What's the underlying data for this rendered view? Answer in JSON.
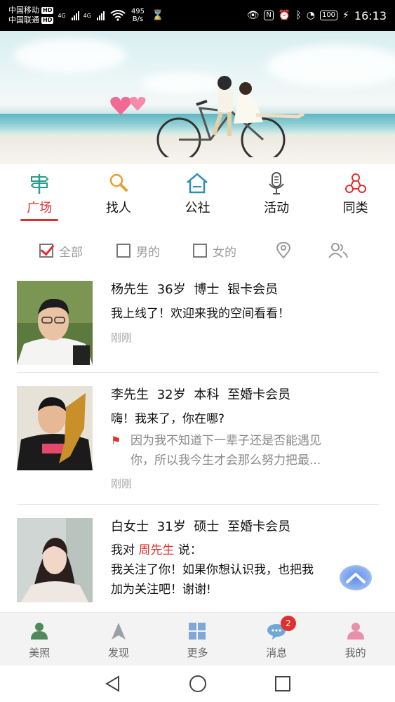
{
  "status_bar": {
    "carrier1": "中国移动",
    "carrier2": "中国联通",
    "hd_label": "HD",
    "net1": "4G",
    "net2": "4G",
    "speed_value": "495",
    "speed_unit": "B/s",
    "battery": "100",
    "time": "16:13"
  },
  "top_nav": {
    "items": [
      {
        "label": "广场",
        "icon": "signpost-icon",
        "active": true
      },
      {
        "label": "找人",
        "icon": "search-icon",
        "active": false
      },
      {
        "label": "公社",
        "icon": "home-icon",
        "active": false
      },
      {
        "label": "活动",
        "icon": "microphone-icon",
        "active": false
      },
      {
        "label": "同类",
        "icon": "share-icon",
        "active": false
      }
    ]
  },
  "filters": {
    "all": "全部",
    "male": "男的",
    "female": "女的",
    "location_icon": "location-pin-icon",
    "friends_icon": "people-icon"
  },
  "feed": [
    {
      "name": "杨先生",
      "age": "36岁",
      "education": "博士",
      "membership": "银卡会员",
      "message": "我上线了！欢迎来我的空间看看！",
      "time": "刚刚"
    },
    {
      "name": "李先生",
      "age": "32岁",
      "education": "本科",
      "membership": "至婚卡会员",
      "message": "嗨！我来了，你在哪?",
      "quote_line1": "因为我不知道下一辈子还是否能遇见",
      "quote_line2": "你，所以我今生才会那么努力把最...",
      "time": "刚刚"
    },
    {
      "name": "白女士",
      "age": "31岁",
      "education": "硕士",
      "membership": "至婚卡会员",
      "msg_prefix": "我对",
      "msg_target": "周先生",
      "msg_suffix": "说：",
      "msg_line2": "我关注了你！如果你想认识我，也把我",
      "msg_line3": "加为关注吧！谢谢!"
    }
  ],
  "tabbar": {
    "items": [
      {
        "label": "美照",
        "icon": "person-icon"
      },
      {
        "label": "发现",
        "icon": "compass-arrow-icon"
      },
      {
        "label": "更多",
        "icon": "grid-icon"
      },
      {
        "label": "消息",
        "icon": "chat-bubble-icon",
        "badge": "2"
      },
      {
        "label": "我的",
        "icon": "profile-icon"
      }
    ]
  },
  "colors": {
    "accent": "#e0302e",
    "text": "#111111",
    "muted": "#999999"
  }
}
